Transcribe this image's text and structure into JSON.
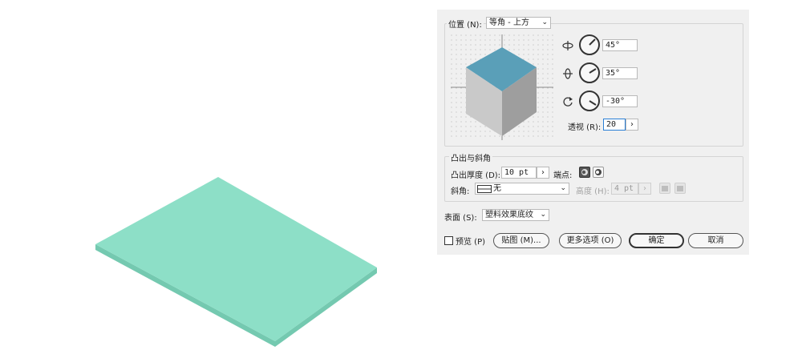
{
  "colors": {
    "slab_top": "#8ddfc7",
    "slab_side": "#74c9b0",
    "cube_top": "#5a9fb8",
    "cube_left": "#c9c9c9",
    "cube_right": "#9e9e9e",
    "dialog_bg": "#f0f0f0"
  },
  "position": {
    "label": "位置 (N):",
    "value": "等角 - 上方",
    "x_rotation_icon": "rotate-x-icon",
    "x_rotation": "45°",
    "y_rotation_icon": "rotate-y-icon",
    "y_rotation": "35°",
    "z_rotation_icon": "rotate-z-icon",
    "z_rotation": "-30°",
    "perspective_label": "透视 (R):",
    "perspective": "20",
    "stepper": "›"
  },
  "extrude": {
    "title": "凸出与斜角",
    "depth_label": "凸出厚度 (D):",
    "depth": "10 pt",
    "depth_stepper": "›",
    "cap_label": "端点:",
    "bevel_label": "斜角:",
    "bevel": "无",
    "height_label": "高度 (H):",
    "height": "4 pt",
    "height_stepper": "›"
  },
  "surface": {
    "label": "表面 (S):",
    "value": "塑料效果底纹"
  },
  "footer": {
    "preview_label": "预览 (P)",
    "map_button": "贴图 (M)...",
    "more_options_button": "更多选项 (O)",
    "ok_button": "确定",
    "cancel_button": "取消"
  }
}
